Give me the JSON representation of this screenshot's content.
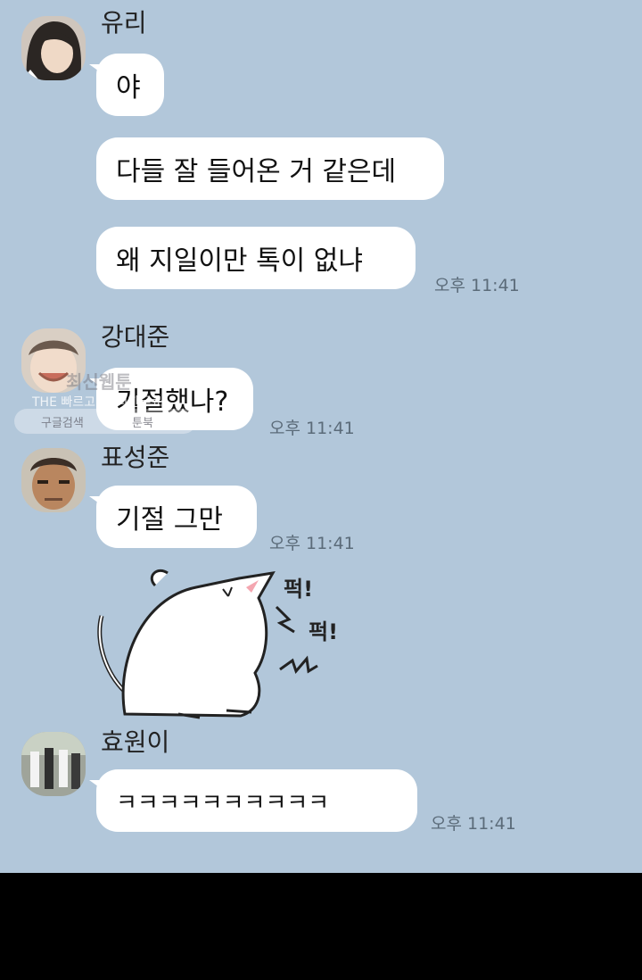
{
  "messages": [
    {
      "sender": "유리",
      "bubbles": [
        "야",
        "다들 잘 들어온 거 같은데",
        "왜 지일이만 톡이 없냐"
      ],
      "time": "오후 11:41"
    },
    {
      "sender": "강대준",
      "bubbles": [
        "기절했나?"
      ],
      "time": "오후 11:41"
    },
    {
      "sender": "표성준",
      "bubbles": [
        "기절 그만"
      ],
      "time": "오후 11:41"
    },
    {
      "sender": "효원이",
      "bubbles": [
        "ㅋㅋㅋㅋㅋㅋㅋㅋㅋㅋ"
      ],
      "time": "오후 11:41"
    }
  ],
  "sticker": {
    "text_1": "퍽!",
    "text_2": "퍽!"
  },
  "watermark": {
    "title": "최신웹툰",
    "subtitle": "THE 빠르고 TH리한무료",
    "google": "구글검색",
    "toonbook": "툰북"
  },
  "colors": {
    "chat_background": "#b2c7da",
    "bubble": "#ffffff",
    "bottom_bar": "#000000"
  },
  "icons": [
    "avatar-yuri",
    "avatar-kang-daejun",
    "avatar-pyo-seongjun",
    "avatar-hyowon",
    "cat-sticker"
  ]
}
